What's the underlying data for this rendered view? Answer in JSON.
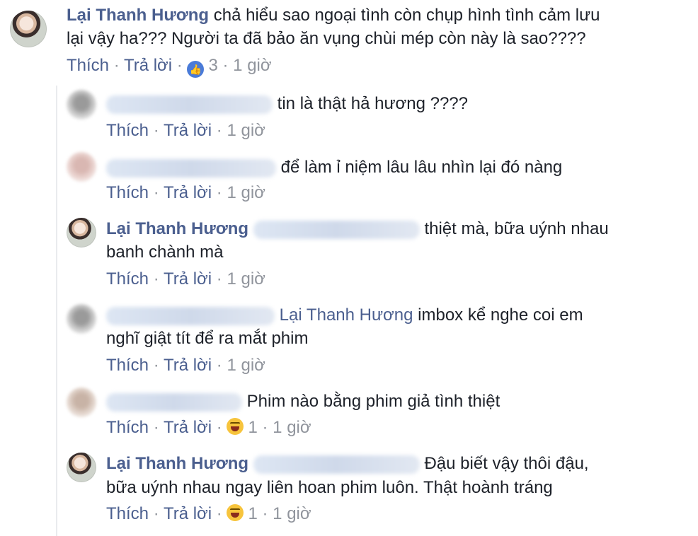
{
  "actions": {
    "like": "Thích",
    "reply": "Trả lời",
    "dot": "·"
  },
  "comment_main": {
    "author": "Lại Thanh Hương",
    "text_line1": "chả hiểu sao ngoại tình còn chụp hình tình cảm lưu",
    "text_line2": "lại vậy ha??? Người ta đã bảo ăn vụng chùi mép còn này là sao????",
    "reaction_count": "3",
    "time": "1 giờ"
  },
  "replies": [
    {
      "text": "tin là thật hả hương ????",
      "time": "1 giờ"
    },
    {
      "text": "để làm ỉ niệm lâu lâu nhìn lại đó nàng",
      "time": "1 giờ"
    },
    {
      "author": "Lại Thanh Hương",
      "text_line1": "thiệt mà, bữa uýnh nhau",
      "text_line2": "banh chành mà",
      "time": "1 giờ"
    },
    {
      "mention": "Lại Thanh Hương",
      "text_line1": "imbox kể nghe coi em",
      "text_line2": "nghĩ giật tít để ra mắt phim",
      "time": "1 giờ"
    },
    {
      "text": "Phim nào bằng phim giả tình thiệt",
      "reaction_count": "1",
      "time": "1 giờ"
    },
    {
      "author": "Lại Thanh Hương",
      "text_line1": "Đậu biết vậy thôi đậu,",
      "text_line2": "bữa uýnh nhau ngay liên hoan phim luôn. Thật hoành tráng",
      "reaction_count": "1",
      "time": "1 giờ"
    }
  ]
}
